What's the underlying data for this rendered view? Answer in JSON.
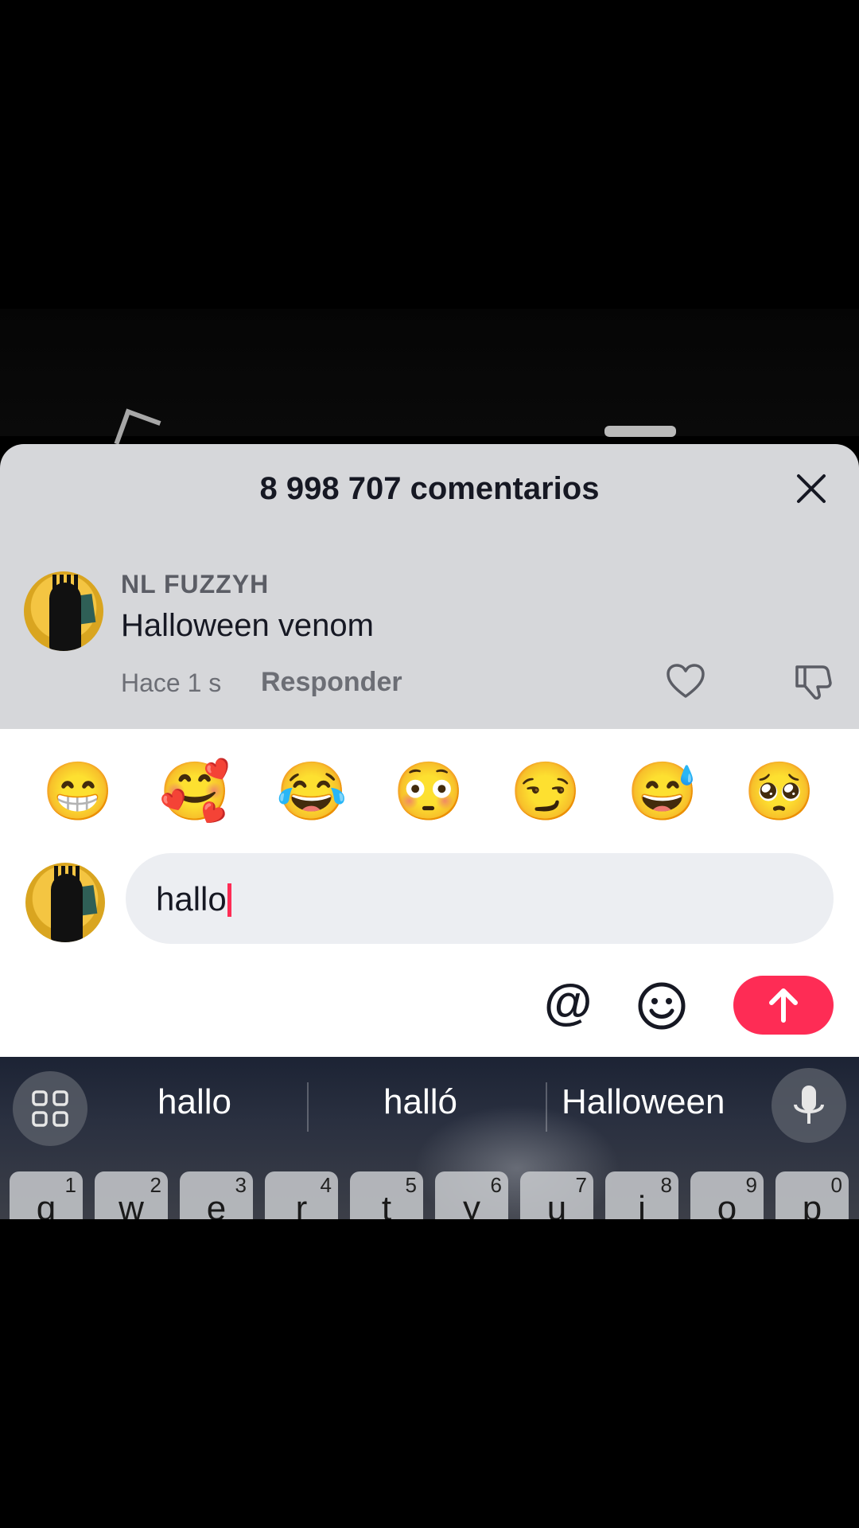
{
  "comments_sheet": {
    "title": "8 998 707 comentarios",
    "comment": {
      "username": "NL FUZZYH",
      "text": "Halloween venom",
      "time": "Hace 1 s",
      "reply_label": "Responder"
    }
  },
  "emoji_bar": [
    "😁",
    "🥰",
    "😂",
    "😳",
    "😏",
    "😅",
    "🥺"
  ],
  "composer": {
    "input_value": "hallo"
  },
  "keyboard": {
    "suggestions": [
      "hallo",
      "halló",
      "Halloween"
    ],
    "row1": [
      {
        "ch": "q",
        "num": "1"
      },
      {
        "ch": "w",
        "num": "2"
      },
      {
        "ch": "e",
        "num": "3"
      },
      {
        "ch": "r",
        "num": "4"
      },
      {
        "ch": "t",
        "num": "5"
      },
      {
        "ch": "y",
        "num": "6"
      },
      {
        "ch": "u",
        "num": "7"
      },
      {
        "ch": "i",
        "num": "8"
      },
      {
        "ch": "o",
        "num": "9"
      },
      {
        "ch": "p",
        "num": "0"
      }
    ]
  },
  "colors": {
    "accent": "#fe2c55",
    "sheet_bg": "#d6d7da",
    "input_bg": "#eceef2"
  }
}
